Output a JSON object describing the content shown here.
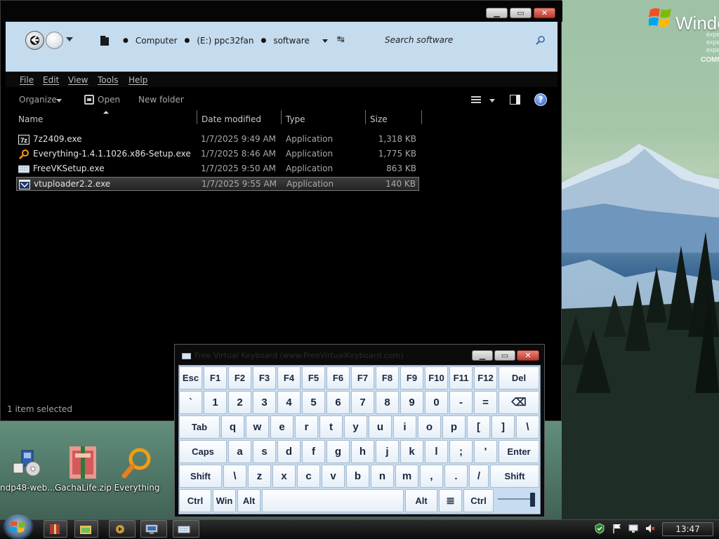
{
  "explorer": {
    "breadcrumb": [
      "Computer",
      "(E:) ppc32fan",
      "software"
    ],
    "search_placeholder": "Search software",
    "menu": [
      "File",
      "Edit",
      "View",
      "Tools",
      "Help"
    ],
    "toolbar": {
      "organize": "Organize",
      "open": "Open",
      "new_folder": "New folder"
    },
    "columns": {
      "name": "Name",
      "date": "Date modified",
      "type": "Type",
      "size": "Size"
    },
    "files": [
      {
        "name": "7z2409.exe",
        "date": "1/7/2025 9:49 AM",
        "type": "Application",
        "size": "1,318 KB",
        "icon": "7zip-icon",
        "selected": false
      },
      {
        "name": "Everything-1.4.1.1026.x86-Setup.exe",
        "date": "1/7/2025 8:46 AM",
        "type": "Application",
        "size": "1,775 KB",
        "icon": "everything-icon",
        "selected": false
      },
      {
        "name": "FreeVKSetup.exe",
        "date": "1/7/2025 9:50 AM",
        "type": "Application",
        "size": "863 KB",
        "icon": "keyboard-icon",
        "selected": false
      },
      {
        "name": "vtuploader2.2.exe",
        "date": "1/7/2025 9:55 AM",
        "type": "Application",
        "size": "140 KB",
        "icon": "app-icon",
        "selected": true
      }
    ],
    "status": "1 item selected"
  },
  "desktop": {
    "wallpaper_logo": {
      "word": "Windo",
      "lines": [
        "expe",
        "expe",
        "expe"
      ],
      "comm": "COMM"
    },
    "icons": [
      {
        "label": "ndp48-web....",
        "icon": "dotnet-installer-icon"
      },
      {
        "label": "GachaLife.zip",
        "icon": "zip-archive-icon"
      },
      {
        "label": "Everything",
        "icon": "everything-icon"
      }
    ]
  },
  "keyboard": {
    "title": "Free Virtual Keyboard (www.FreeVirtualKeyboard.com)",
    "rows": [
      [
        "Esc",
        "F1",
        "F2",
        "F3",
        "F4",
        "F5",
        "F6",
        "F7",
        "F8",
        "F9",
        "F10",
        "F11",
        "F12",
        "Del"
      ],
      [
        "`",
        "1",
        "2",
        "3",
        "4",
        "5",
        "6",
        "7",
        "8",
        "9",
        "0",
        "-",
        "=",
        "⌫"
      ],
      [
        "Tab",
        "q",
        "w",
        "e",
        "r",
        "t",
        "y",
        "u",
        "i",
        "o",
        "p",
        "[",
        "]",
        "\\"
      ],
      [
        "Caps",
        "a",
        "s",
        "d",
        "f",
        "g",
        "h",
        "j",
        "k",
        "l",
        ";",
        "'",
        "Enter"
      ],
      [
        "Shift",
        "\\",
        "z",
        "x",
        "c",
        "v",
        "b",
        "n",
        "m",
        ",",
        ".",
        "/",
        "Shift"
      ],
      [
        "Ctrl",
        "Win",
        "Alt",
        "",
        "Alt",
        "≣",
        "Ctrl"
      ]
    ],
    "opacity_slider": 0.95
  },
  "taskbar": {
    "clock": "13:47",
    "buttons": [
      "winrar-icon",
      "explorer-icon",
      "media-icon",
      "remote-icon",
      "keyboard-icon"
    ],
    "tray": [
      "security-icon",
      "flag-icon",
      "network-icon",
      "volume-muted-icon"
    ]
  },
  "colors": {
    "address_bar": "#c5dcef",
    "keyboard_body": "#c8dcf0",
    "key_text": "#1a2740"
  }
}
